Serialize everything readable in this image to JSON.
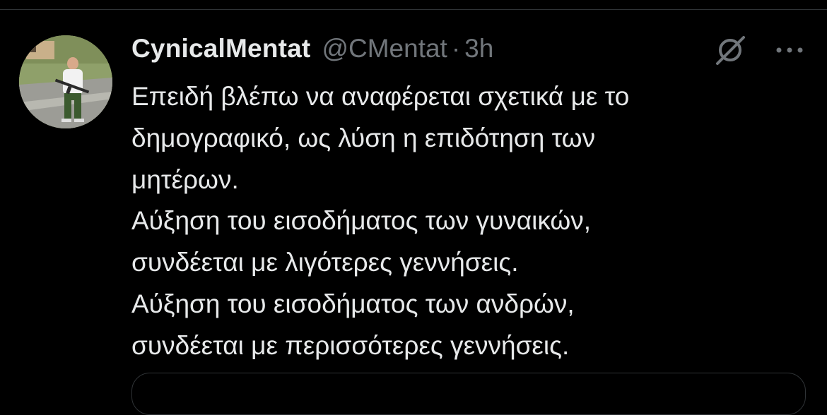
{
  "tweet": {
    "author": {
      "display_name": "CynicalMentat",
      "handle": "@CMentat"
    },
    "separator": "·",
    "timestamp": "3h",
    "lines": [
      "Επειδή βλέπω να αναφέρεται σχετικά με το",
      "δημογραφικό, ως λύση η επιδότηση των",
      "μητέρων.",
      "Αύξηση του εισοδήματος των γυναικών,",
      "συνδέεται με λιγότερες γεννήσεις.",
      "Αύξηση του εισοδήματος των ανδρών,",
      "συνδέεται με περισσότερες γεννήσεις."
    ]
  },
  "icons": {
    "grok": "grok-icon",
    "more": "more-options-icon"
  },
  "colors": {
    "background": "#000000",
    "primary_text": "#e7e9ea",
    "secondary_text": "#71767b",
    "divider": "#2f3336"
  }
}
